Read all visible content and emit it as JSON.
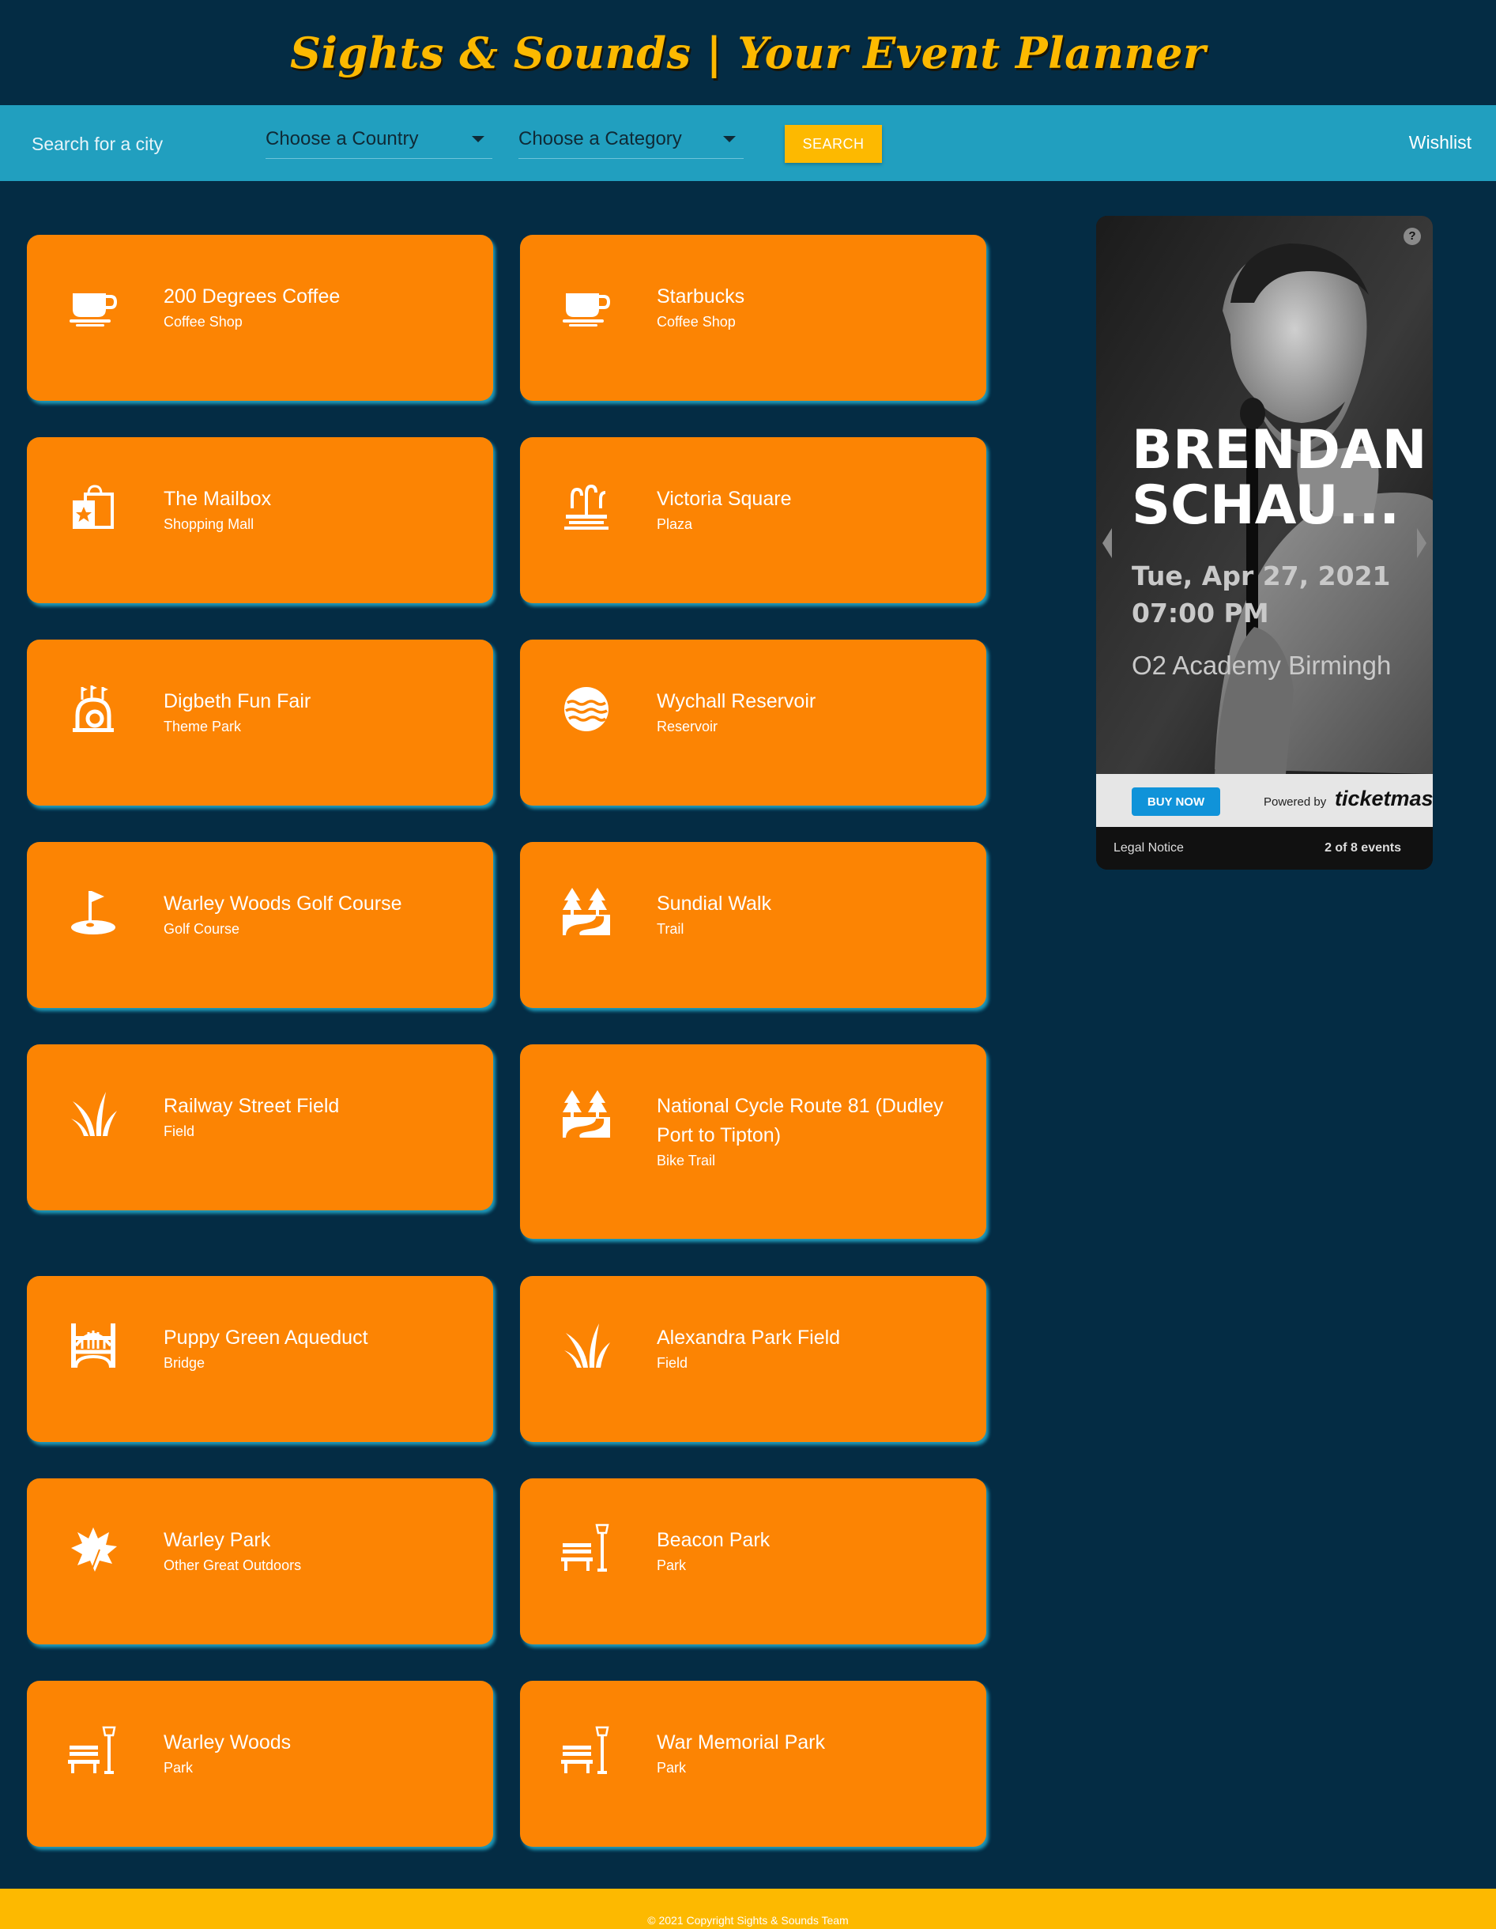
{
  "header": {
    "title": "Sights & Sounds | Your Event Planner"
  },
  "navbar": {
    "search_placeholder": "Search for a city",
    "country_label": "Choose a Country",
    "category_label": "Choose a Category",
    "search_label": "SEARCH",
    "wishlist_label": "Wishlist"
  },
  "places": [
    {
      "name": "200 Degrees Coffee",
      "category": "Coffee Shop",
      "icon": "coffee-icon"
    },
    {
      "name": "Starbucks",
      "category": "Coffee Shop",
      "icon": "coffee-icon"
    },
    {
      "name": "The Mailbox",
      "category": "Shopping Mall",
      "icon": "shopping-bag-icon"
    },
    {
      "name": "Victoria Square",
      "category": "Plaza",
      "icon": "fountain-icon"
    },
    {
      "name": "Digbeth Fun Fair",
      "category": "Theme Park",
      "icon": "rollercoaster-icon"
    },
    {
      "name": "Wychall Reservoir",
      "category": "Reservoir",
      "icon": "reservoir-icon"
    },
    {
      "name": "Warley Woods Golf Course",
      "category": "Golf Course",
      "icon": "golf-icon"
    },
    {
      "name": "Sundial Walk",
      "category": "Trail",
      "icon": "trail-icon"
    },
    {
      "name": "Railway Street Field",
      "category": "Field",
      "icon": "grass-icon"
    },
    {
      "name": "National Cycle Route 81 (Dudley Port to Tipton)",
      "category": "Bike Trail",
      "icon": "trail-icon"
    },
    {
      "name": "Puppy Green Aqueduct",
      "category": "Bridge",
      "icon": "bridge-icon"
    },
    {
      "name": "Alexandra Park Field",
      "category": "Field",
      "icon": "grass-icon"
    },
    {
      "name": "Warley Park",
      "category": "Other Great Outdoors",
      "icon": "leaf-icon"
    },
    {
      "name": "Beacon Park",
      "category": "Park",
      "icon": "park-bench-icon"
    },
    {
      "name": "Warley Woods",
      "category": "Park",
      "icon": "park-bench-icon"
    },
    {
      "name": "War Memorial Park",
      "category": "Park",
      "icon": "park-bench-icon"
    }
  ],
  "ad": {
    "help": "?",
    "event_name_line1": "BRENDAN",
    "event_name_line2": "SCHAU...",
    "date_line1": "Tue, Apr 27, 2021",
    "date_line2": "07:00 PM",
    "venue": "O2 Academy Birmingh",
    "buy_label": "BUY NOW",
    "powered_by": "Powered by",
    "brand": "ticketmaster",
    "legal": "Legal Notice",
    "count": "2 of 8 events"
  },
  "footer": {
    "copyright": "© 2021 Copyright Sights & Sounds Team"
  },
  "colors": {
    "background": "#042c44",
    "navbar": "#219fbf",
    "card": "#fc8403",
    "accent": "#fdb900"
  }
}
